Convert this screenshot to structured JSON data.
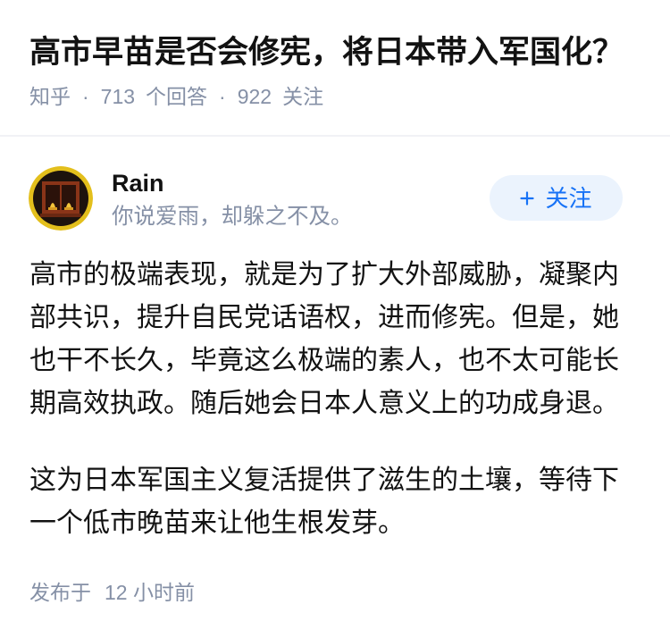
{
  "question": {
    "title": "高市早苗是否会修宪，将日本带入军国化？",
    "meta": {
      "source": "知乎",
      "separator": "·",
      "answer_count": "713",
      "answer_label": "个回答",
      "follower_count": "922",
      "follower_label": "关注"
    }
  },
  "author": {
    "name": "Rain",
    "bio": "你说爱雨，却躲之不及。",
    "avatar_icon": "avatar-image"
  },
  "follow_button": {
    "icon": "plus-icon",
    "label": "关注"
  },
  "answer": {
    "paragraphs": [
      "高市的极端表现，就是为了扩大外部威胁，凝聚内部共识，提升自民党话语权，进而修宪。但是，她也干不长久，毕竟这么极端的素人，也不太可能长期高效执政。随后她会日本人意义上的功成身退。",
      "这为日本军国主义复活提供了滋生的土壤，等待下一个低市晚苗来让他生根发芽。"
    ]
  },
  "footer": {
    "published_label": "发布于",
    "published_time": "12 小时前"
  },
  "colors": {
    "text": "#121212",
    "muted": "#8590a6",
    "brand": "#1772f6",
    "follow_bg": "#ebf3fd",
    "divider": "#f1f2f5"
  }
}
